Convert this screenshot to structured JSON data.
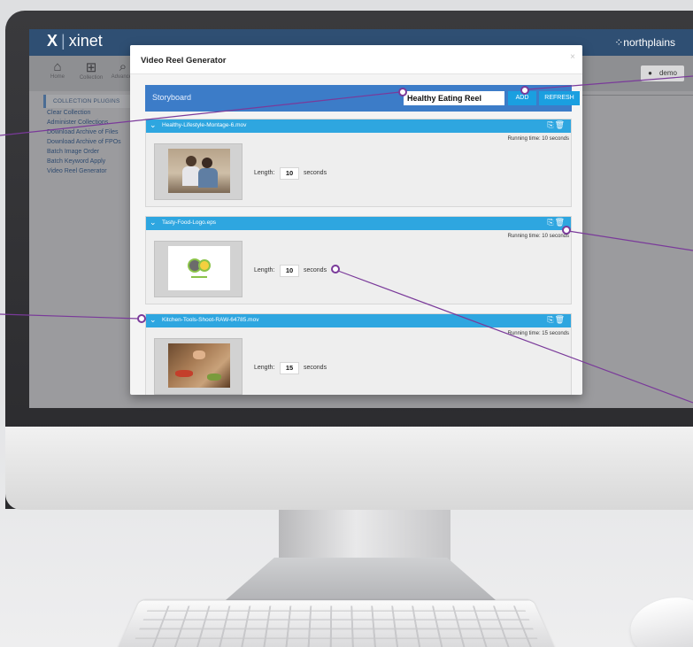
{
  "app": {
    "logo_x": "X",
    "logo_name": "xinet",
    "brand": "northplains",
    "user": "demo"
  },
  "toolbar": {
    "items": [
      {
        "label": "Home",
        "icon": "home-icon"
      },
      {
        "label": "Collection",
        "icon": "cart-icon"
      },
      {
        "label": "Advanced",
        "icon": "search-icon"
      }
    ]
  },
  "sidebar": {
    "header": "COLLECTION PLUGINS",
    "items": [
      "Clear Collection",
      "Administer Collections",
      "Download Archive of Files",
      "Download Archive of FPOs",
      "Batch Image Order",
      "Batch Keyword Apply",
      "Video Reel Generator"
    ]
  },
  "modal": {
    "title": "Video Reel Generator",
    "close": "×",
    "storyboard_label": "Storyboard",
    "reel_name": "Healthy Eating Reel",
    "add_label": "ADD",
    "refresh_label": "REFRESH",
    "length_label": "Length:",
    "unit_label": "seconds"
  },
  "clips": [
    {
      "name": "Healthy-Lifestyle-Montage-6.mov",
      "running": "Running time: 10 seconds",
      "length": "10",
      "thumb": "people"
    },
    {
      "name": "Tasty-Food-Logo.eps",
      "running": "Running time: 10 seconds",
      "length": "10",
      "thumb": "logo"
    },
    {
      "name": "Kitchen-Tools-Shoot-RAW-64785.mov",
      "running": "Running time: 15 seconds",
      "length": "15",
      "thumb": "food"
    }
  ],
  "colors": {
    "header": "#2f4f73",
    "storyboard_bar": "#3c7cc8",
    "clip_bar": "#2ea6e0",
    "button": "#1a9fe0",
    "callout": "#7a3a9a"
  }
}
